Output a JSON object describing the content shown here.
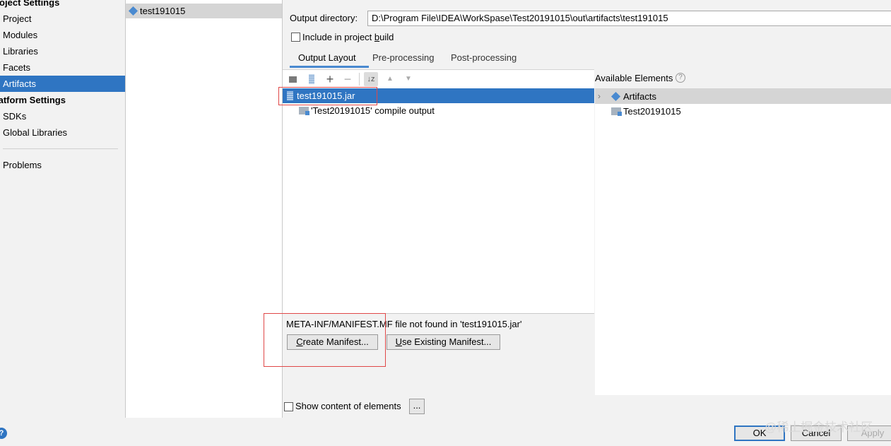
{
  "sidebar": {
    "project_settings_heading": "roject Settings",
    "project_items": [
      "Project",
      "Modules",
      "Libraries",
      "Facets",
      "Artifacts"
    ],
    "platform_settings_heading": "latform Settings",
    "platform_items": [
      "SDKs",
      "Global Libraries"
    ],
    "problems": "Problems"
  },
  "artifact_list": {
    "selected_artifact": "test191015"
  },
  "config": {
    "output_dir_label": "Output directory:",
    "output_dir_value": "D:\\Program File\\IDEA\\WorkSpase\\Test20191015\\out\\artifacts\\test191015",
    "include_build_pre": "Include in project ",
    "include_build_u": "b",
    "include_build_post": "uild",
    "tabs": [
      "Output Layout",
      "Pre-processing",
      "Post-processing"
    ]
  },
  "layout_tree": {
    "root": "test191015.jar",
    "child": "'Test20191015' compile output"
  },
  "available": {
    "title": "Available Elements",
    "items": [
      "Artifacts",
      "Test20191015"
    ]
  },
  "manifest": {
    "message": "META-INF/MANIFEST.MF file not found in 'test191015.jar'",
    "create_u": "C",
    "create_rest": "reate Manifest...",
    "existing_u": "U",
    "existing_rest": "se Existing Manifest..."
  },
  "show_content": {
    "label": "Show content of elements",
    "more": "..."
  },
  "dialog": {
    "help": "?",
    "ok": "OK",
    "cancel": "Cancel",
    "apply": "Apply"
  },
  "watermark": "@稀土掘金技术社区",
  "colors": {
    "selection": "#2f75c2",
    "accent": "#4a8ad0",
    "highlight_box": "#e04848"
  }
}
